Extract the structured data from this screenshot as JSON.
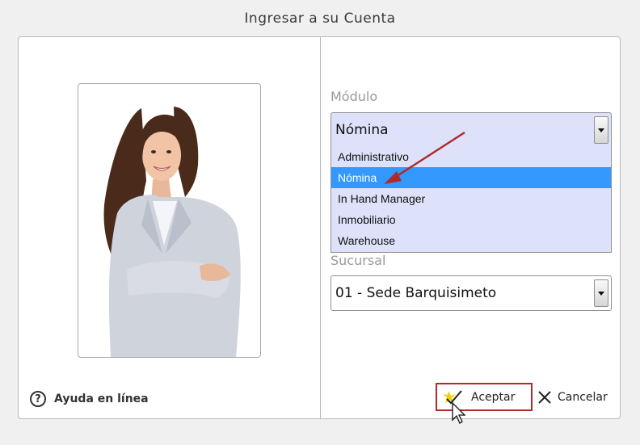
{
  "window": {
    "title": "Ingresar a su Cuenta"
  },
  "help": {
    "label": "Ayuda en línea",
    "icon": "question-circle-icon"
  },
  "modulo": {
    "label": "Módulo",
    "selected": "Nómina",
    "options": [
      "Administrativo",
      "Nómina",
      "In Hand Manager",
      "Inmobiliario",
      "Warehouse"
    ],
    "selected_index": 1
  },
  "sucursal": {
    "label": "Sucursal",
    "selected": "01 - Sede Barquisimeto"
  },
  "buttons": {
    "accept_label": "Aceptar",
    "cancel_label": "Cancelar"
  },
  "colors": {
    "dropdown_bg": "#dde2fa",
    "highlight": "#3399ff",
    "annotation_red": "#b02a2a"
  }
}
